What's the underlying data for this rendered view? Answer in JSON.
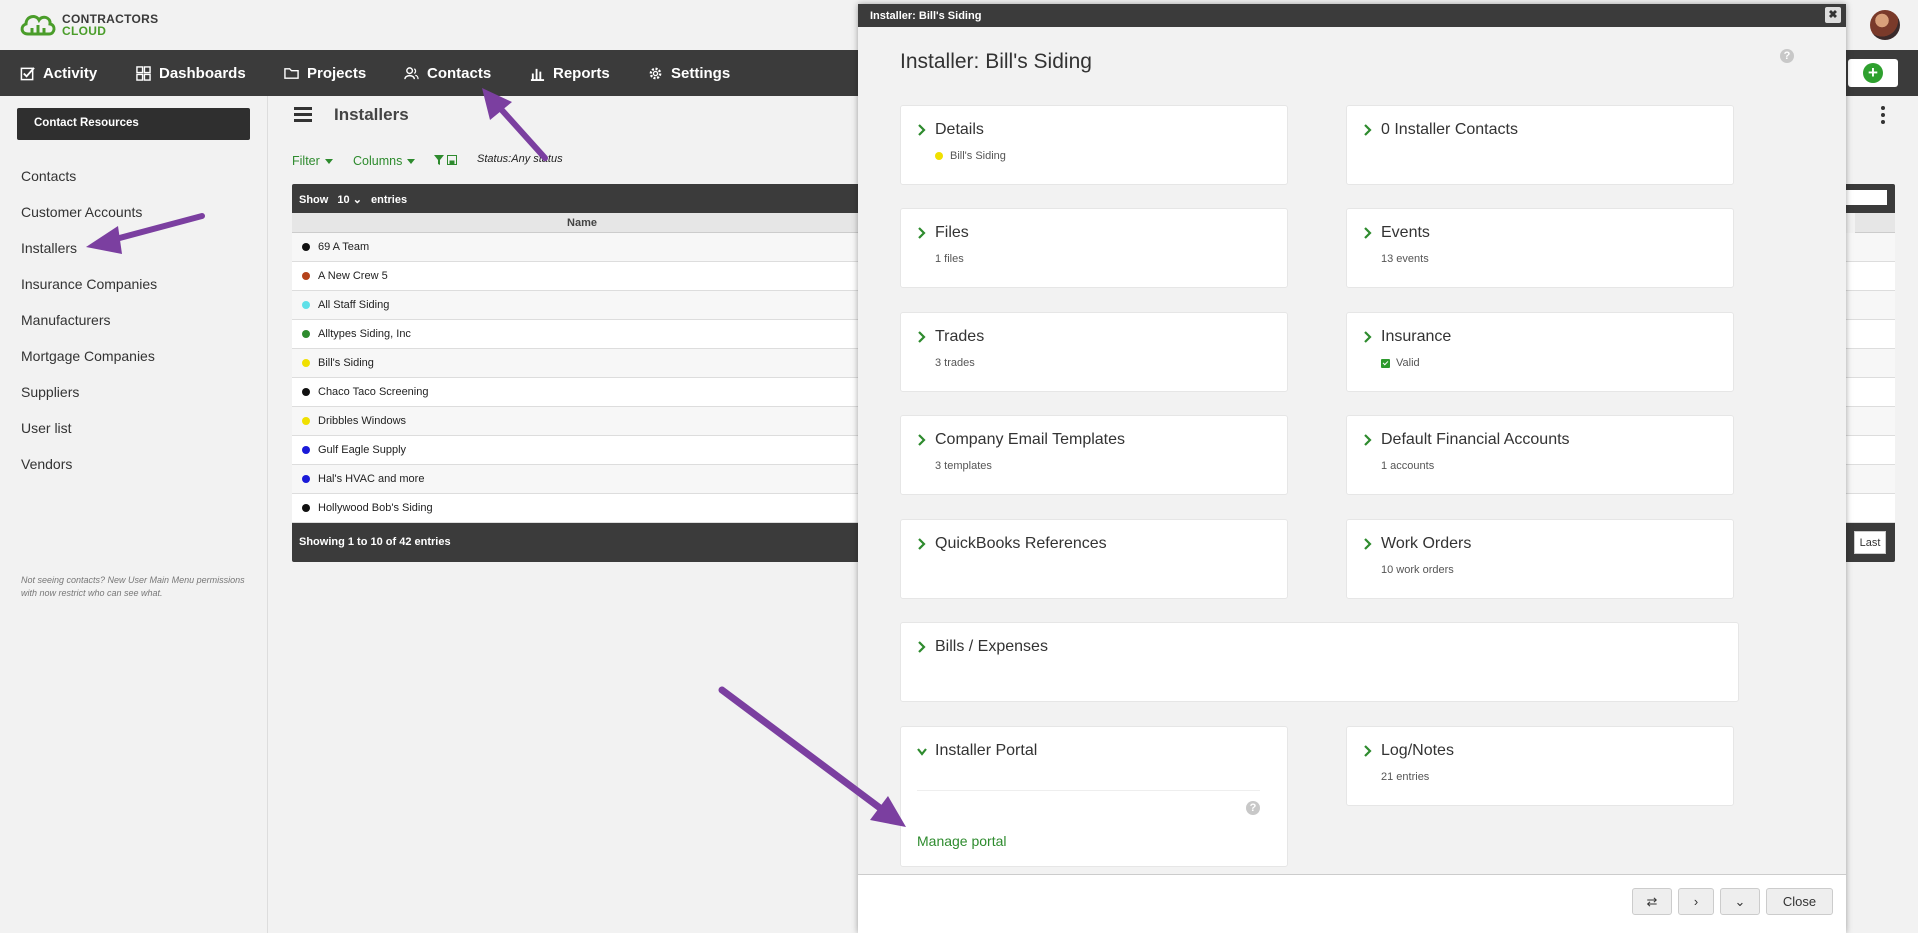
{
  "brand": {
    "line1": "CONTRACTORS",
    "line2": "CLOUD"
  },
  "nav": {
    "items": [
      {
        "label": "Activity",
        "icon": "checkbox-icon"
      },
      {
        "label": "Dashboards",
        "icon": "grid-icon"
      },
      {
        "label": "Projects",
        "icon": "folder-icon"
      },
      {
        "label": "Contacts",
        "icon": "people-icon"
      },
      {
        "label": "Reports",
        "icon": "bar-chart-icon"
      },
      {
        "label": "Settings",
        "icon": "gear-icon"
      }
    ],
    "add_icon": "+"
  },
  "sidebar": {
    "header": "Contact Resources",
    "items": [
      "Contacts",
      "Customer Accounts",
      "Installers",
      "Insurance Companies",
      "Manufacturers",
      "Mortgage Companies",
      "Suppliers",
      "User list",
      "Vendors"
    ],
    "note": "Not seeing contacts? New User Main Menu permissions with now restrict who can see what."
  },
  "main": {
    "title": "Installers",
    "filter_label": "Filter",
    "columns_label": "Columns",
    "status_text": "Status:Any status",
    "table": {
      "show_label": "Show",
      "show_value": "10",
      "entries_label": "entries",
      "column_header": "Name",
      "rows": [
        {
          "name": "69 A Team",
          "color": "#111111"
        },
        {
          "name": "A New Crew 5",
          "color": "#b5421a"
        },
        {
          "name": "All Staff Siding",
          "color": "#5fe0e8"
        },
        {
          "name": "Alltypes Siding, Inc",
          "color": "#2e8b2e"
        },
        {
          "name": "Bill's Siding",
          "color": "#f0e000"
        },
        {
          "name": "Chaco Taco Screening",
          "color": "#111111"
        },
        {
          "name": "Dribbles Windows",
          "color": "#f0e000"
        },
        {
          "name": "Gulf Eagle Supply",
          "color": "#1a1ad8"
        },
        {
          "name": "Hal's HVAC and more",
          "color": "#1a1ad8"
        },
        {
          "name": "Hollywood Bob's Siding",
          "color": "#111111"
        }
      ],
      "footer": "Showing 1 to 10 of 42 entries",
      "last_label": "Last"
    }
  },
  "modal": {
    "titlebar": "Installer: Bill's Siding",
    "close_x": "✖",
    "heading": "Installer: Bill's Siding",
    "help": "?",
    "cards": {
      "details": {
        "title": "Details",
        "sub": "Bill's Siding",
        "dot_color": "#f0e000"
      },
      "contacts": {
        "title": "0 Installer Contacts"
      },
      "files": {
        "title": "Files",
        "sub": "1 files"
      },
      "events": {
        "title": "Events",
        "sub": "13 events"
      },
      "trades": {
        "title": "Trades",
        "sub": "3 trades"
      },
      "insurance": {
        "title": "Insurance",
        "sub": "Valid"
      },
      "email_templates": {
        "title": "Company Email Templates",
        "sub": "3 templates"
      },
      "financial": {
        "title": "Default Financial Accounts",
        "sub": "1 accounts"
      },
      "quickbooks": {
        "title": "QuickBooks References"
      },
      "work_orders": {
        "title": "Work Orders",
        "sub": "10 work orders"
      },
      "bills": {
        "title": "Bills / Expenses"
      },
      "portal": {
        "title": "Installer Portal",
        "link": "Manage portal"
      },
      "log": {
        "title": "Log/Notes",
        "sub": "21 entries"
      }
    },
    "footer": {
      "close_label": "Close",
      "swap_icon": "⇄",
      "next_icon": "›",
      "down_icon": "⌄"
    }
  },
  "colors": {
    "accent_green": "#2e8b2e",
    "dark_bar": "#3b3b3b",
    "arrow": "#7b3fa0"
  }
}
